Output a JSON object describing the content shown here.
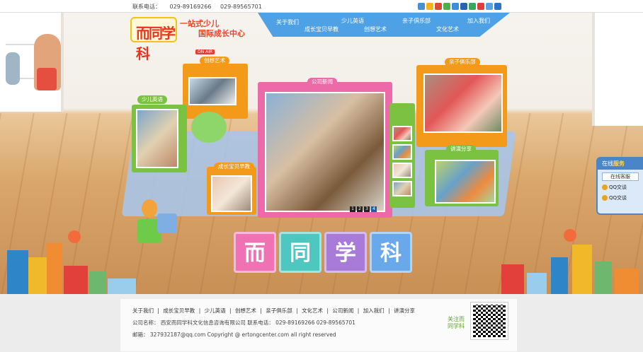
{
  "topbar": {
    "contact_label": "联系电话：",
    "phone1": "029-89169266",
    "phone2": "029-89565701"
  },
  "logo": {
    "text": "而同学科"
  },
  "slogan": {
    "line1": "一站式少儿",
    "line2": "国际成长中心"
  },
  "nav": {
    "items": [
      "关于我们",
      "成长宝贝早教",
      "少儿英语",
      "创想艺术",
      "亲子俱乐部",
      "文化艺术",
      "加入我们"
    ]
  },
  "stage": {
    "box_labels": {
      "creative_art": "创想艺术",
      "onair": "ON AIR",
      "english": "少儿英语",
      "news": "公司新闻",
      "parent_club": "亲子俱乐部",
      "teachers": "讲演分享",
      "baby": "成长宝贝早教"
    },
    "slider_pages": [
      "1",
      "2",
      "3",
      "4"
    ],
    "title_cubes": [
      "而",
      "同",
      "学",
      "科"
    ],
    "colors": {
      "orange": "#f39a1b",
      "green": "#7cc242",
      "pink": "#ec6aa8",
      "blue": "#4fa1e6",
      "cube_pink": "#ee72b4",
      "cube_teal": "#4ec7c0",
      "cube_purple": "#a87bd9",
      "cube_lightblue": "#69a8ea"
    }
  },
  "kefu": {
    "head_plain": "在线",
    "head_bold": "服务",
    "service_btn": "在线客服",
    "qq1": "QQ交谈",
    "qq2": "QQ交谈"
  },
  "footer": {
    "links": [
      "关于我们",
      "|",
      "成长宝贝早教",
      "|",
      "少儿英语",
      "|",
      "创想艺术",
      "|",
      "亲子俱乐部",
      "|",
      "文化艺术",
      "|",
      "公司新闻",
      "|",
      "加入我们",
      "|",
      "讲演分享"
    ],
    "company_line": "公司名称：  西安而同学科文化信息咨询有限公司 联系电话：  029-89169266   029-89565701",
    "email_line": "邮箱：  327932187@qq.com    Copyright @ ertongcenter.com all right reserved",
    "follow_line1": "关注而",
    "follow_line2": "同学科"
  }
}
